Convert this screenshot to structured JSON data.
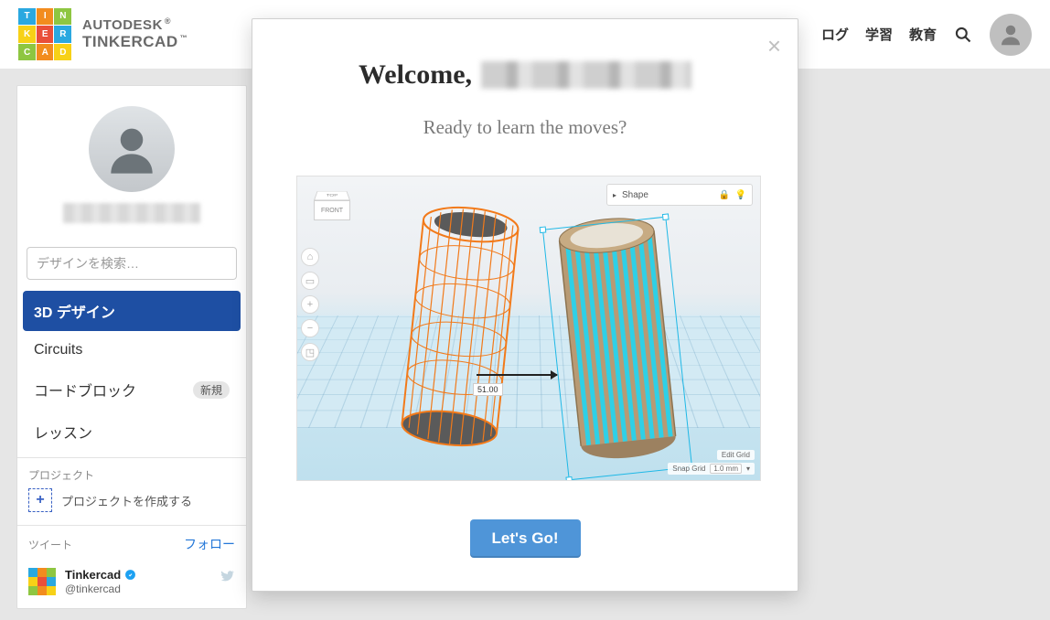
{
  "header": {
    "brand_line1": "AUTODESK",
    "brand_line2": "TINKERCAD",
    "logo_letters": [
      "T",
      "I",
      "N",
      "K",
      "E",
      "R",
      "C",
      "A",
      "D"
    ],
    "nav": {
      "blog": "ログ",
      "learn": "学習",
      "teach": "教育"
    }
  },
  "sidebar": {
    "search_placeholder": "デザインを検索…",
    "tabs": {
      "designs": "3D デザイン",
      "circuits": "Circuits",
      "codeblocks": "コードブロック",
      "lessons": "レッスン",
      "new_badge": "新規"
    },
    "projects_label": "プロジェクト",
    "create_project": "プロジェクトを作成する",
    "tweet_label": "ツイート",
    "follow": "フォロー",
    "tweet_account": "Tinkercad",
    "tweet_handle": "@tinkercad"
  },
  "modal": {
    "welcome_prefix": "Welcome,",
    "subtitle": "Ready to learn the moves?",
    "cta": "Let's Go!",
    "close_symbol": "×",
    "preview": {
      "viewcube_top": "TOP",
      "viewcube_front": "FRONT",
      "shape_label": "Shape",
      "dimension": "51.00",
      "edit_grid": "Edit Grid",
      "snap_grid_label": "Snap Grid",
      "snap_grid_value": "1.0 mm"
    }
  },
  "colors": {
    "accent_blue": "#1e4fa3",
    "cta_blue": "#4f95d8",
    "wire_orange": "#f27a1a",
    "cyl_tan": "#b89a74",
    "sel_cyan": "#1fb8e6"
  }
}
